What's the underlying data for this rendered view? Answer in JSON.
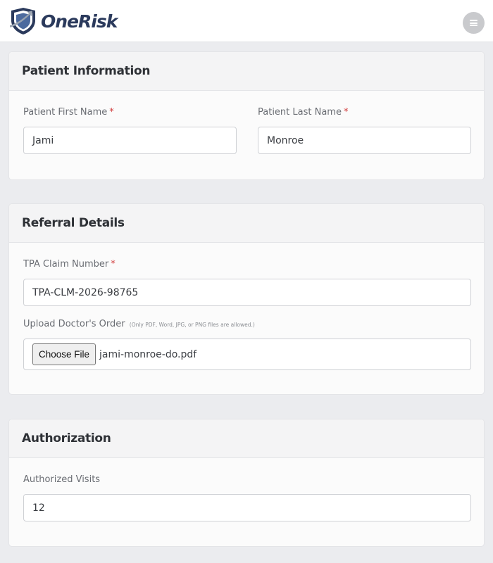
{
  "app": {
    "brand_one": "One",
    "brand_risk": "Risk"
  },
  "patient_info": {
    "title": "Patient Information",
    "first_name_label": "Patient First Name",
    "first_name_value": "Jami",
    "last_name_label": "Patient Last Name",
    "last_name_value": "Monroe",
    "required_mark": "*"
  },
  "referral": {
    "title": "Referral Details",
    "claim_label": "TPA Claim Number",
    "claim_value": "TPA-CLM-2026-98765",
    "upload_label": "Upload Doctor's Order",
    "upload_hint": "(Only PDF, Word, JPG, or PNG files are allowed.)",
    "choose_file_label": "Choose File",
    "file_name": "jami-monroe-do.pdf",
    "required_mark": "*"
  },
  "authorization": {
    "title": "Authorization",
    "visits_label": "Authorized Visits",
    "visits_value": "12"
  },
  "colors": {
    "brand_navy": "#2b3a5c",
    "required_red": "#d13b3b",
    "page_bg": "#ebecef"
  },
  "icons": {
    "logo": "shield-logo-icon",
    "menu": "hamburger-menu-icon"
  }
}
